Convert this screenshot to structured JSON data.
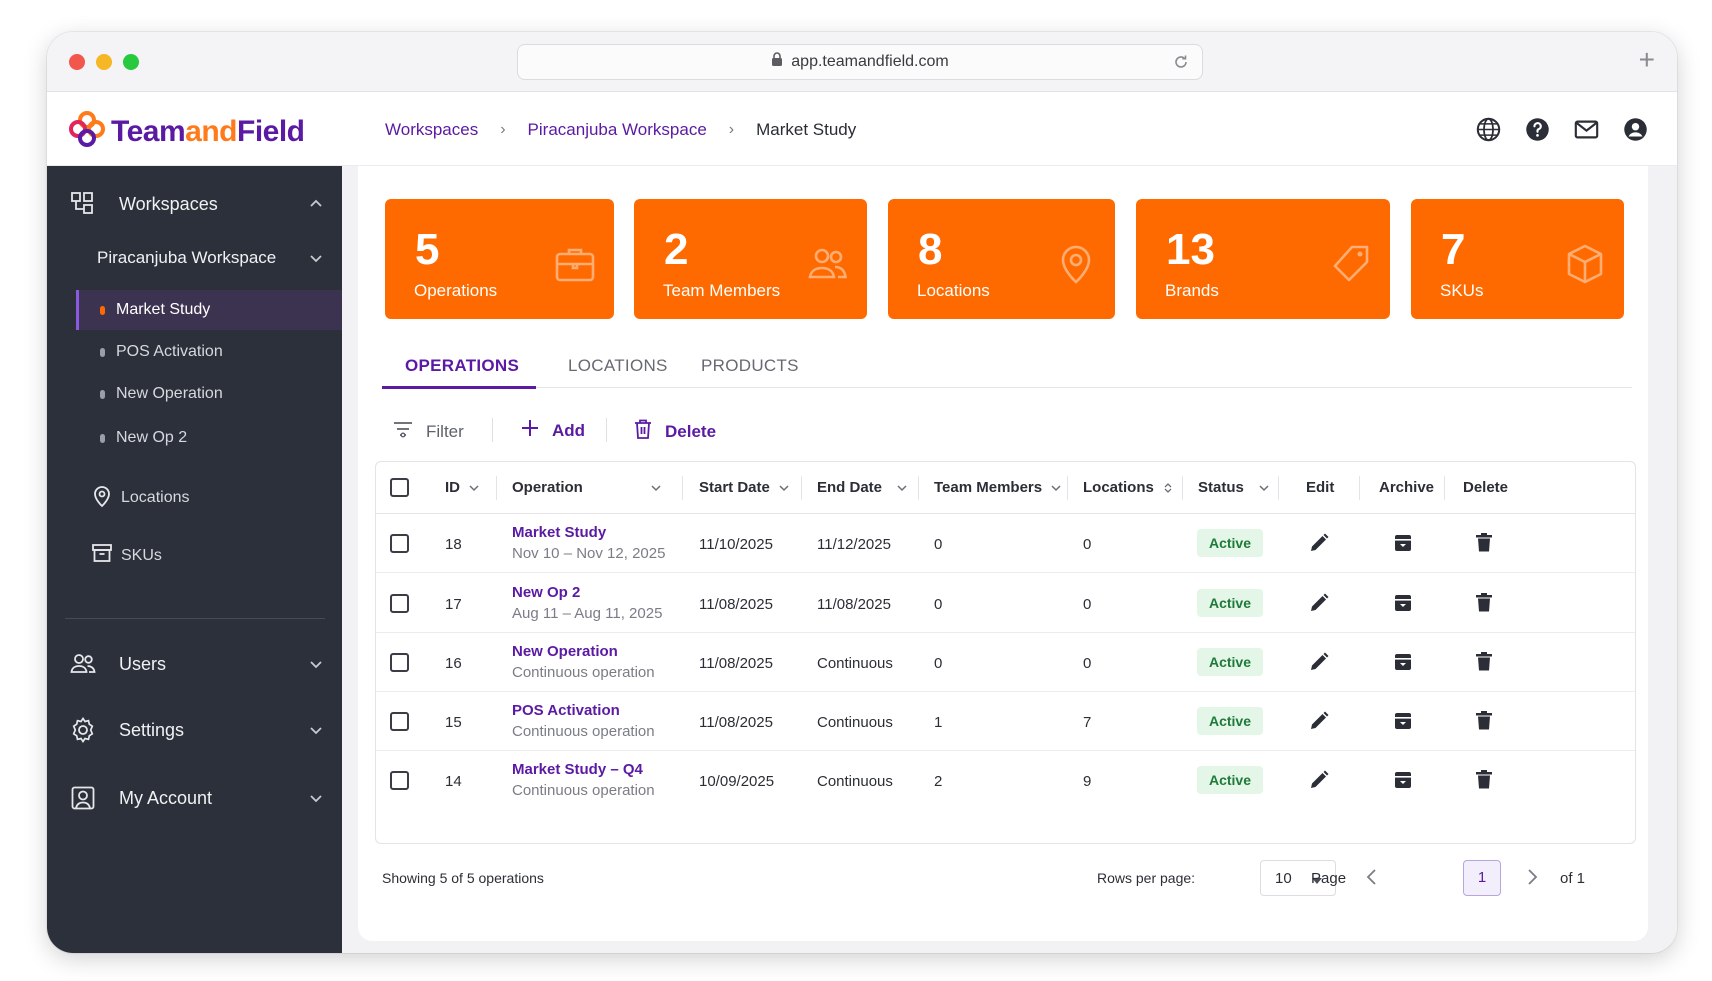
{
  "browser": {
    "url": "app.teamandfield.com"
  },
  "brand": {
    "logo_team": "Team",
    "logo_and": "and",
    "logo_field": "Field"
  },
  "breadcrumb": [
    "Workspaces",
    "Piracanjuba Workspace",
    "Market Study"
  ],
  "sidebar": {
    "workspaces_label": "Workspaces",
    "workspace_name": "Piracanjuba Workspace",
    "operations": [
      "Market Study",
      "POS Activation",
      "New Operation",
      "New Op 2"
    ],
    "locations_label": "Locations",
    "skus_label": "SKUs",
    "users_label": "Users",
    "settings_label": "Settings",
    "account_label": "My Account"
  },
  "stats": [
    {
      "value": "5",
      "label": "Operations",
      "icon": "briefcase-icon"
    },
    {
      "value": "2",
      "label": "Team Members",
      "icon": "users-icon"
    },
    {
      "value": "8",
      "label": "Locations",
      "icon": "map-pin-icon"
    },
    {
      "value": "13",
      "label": "Brands",
      "icon": "tag-icon"
    },
    {
      "value": "7",
      "label": "SKUs",
      "icon": "box-icon"
    }
  ],
  "tabs": [
    "OPERATIONS",
    "LOCATIONS",
    "PRODUCTS"
  ],
  "toolbar": {
    "filter": "Filter",
    "add": "Add",
    "delete": "Delete"
  },
  "table": {
    "headers": [
      "ID",
      "Operation",
      "Start Date",
      "End Date",
      "Team Members",
      "Locations",
      "Status",
      "Edit",
      "Archive",
      "Delete"
    ],
    "rows": [
      {
        "id": "18",
        "name": "Market Study",
        "sub": "Nov 10 – Nov 12, 2025",
        "start": "11/10/2025",
        "end": "11/12/2025",
        "members": "0",
        "locations": "0",
        "status": "Active"
      },
      {
        "id": "17",
        "name": "New Op 2",
        "sub": "Aug 11 – Aug 11, 2025",
        "start": "11/08/2025",
        "end": "11/08/2025",
        "members": "0",
        "locations": "0",
        "status": "Active"
      },
      {
        "id": "16",
        "name": "New Operation",
        "sub": "Continuous operation",
        "start": "11/08/2025",
        "end": "Continuous",
        "members": "0",
        "locations": "0",
        "status": "Active"
      },
      {
        "id": "15",
        "name": "POS Activation",
        "sub": "Continuous operation",
        "start": "11/08/2025",
        "end": "Continuous",
        "members": "1",
        "locations": "7",
        "status": "Active"
      },
      {
        "id": "14",
        "name": "Market Study – Q4",
        "sub": "Continuous operation",
        "start": "10/09/2025",
        "end": "Continuous",
        "members": "2",
        "locations": "9",
        "status": "Active"
      }
    ]
  },
  "footer": {
    "showing": "Showing 5 of 5 operations",
    "rows_per_page_label": "Rows per page:",
    "rows_per_page": "10",
    "page_label": "Page",
    "page": "1",
    "of": "of 1"
  },
  "colors": {
    "accent": "#5b1aa3",
    "orange": "#ff6a00",
    "sidebar": "#2c303a"
  }
}
